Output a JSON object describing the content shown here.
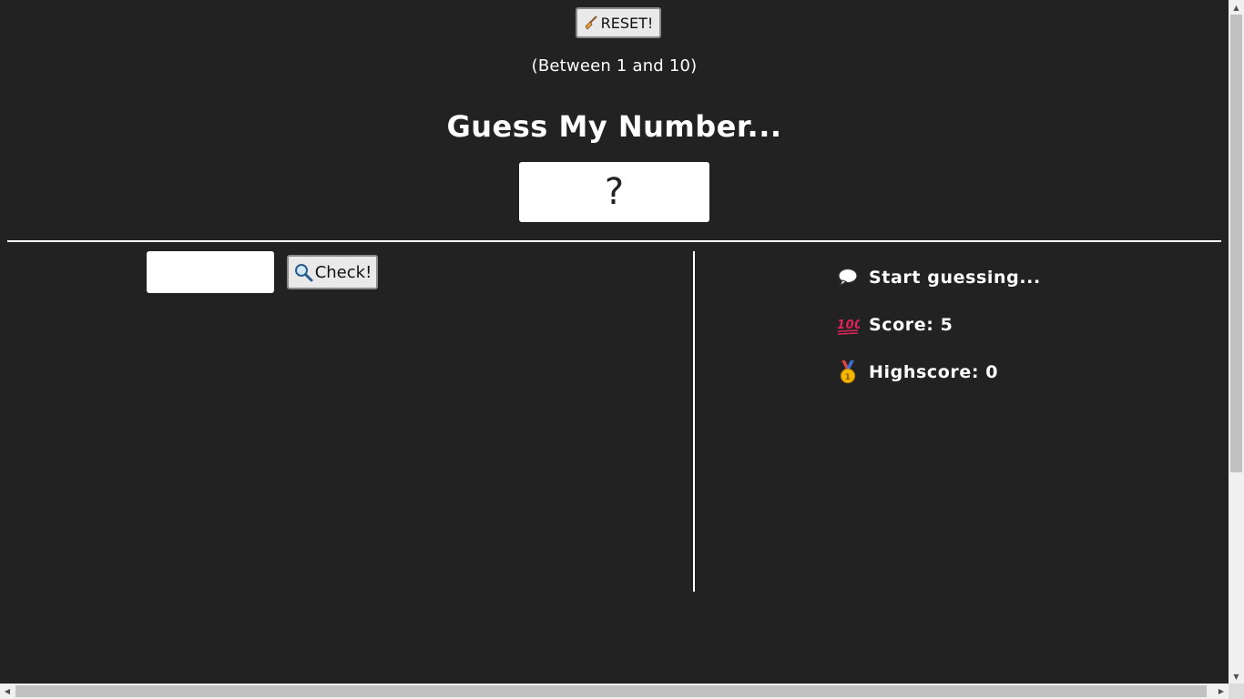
{
  "header": {
    "reset_label": "RESET!",
    "range_text": "(Between 1 and 10)",
    "title": "Guess My Number...",
    "secret_number": "?"
  },
  "guess": {
    "input_value": "",
    "check_label": "Check!"
  },
  "stats": {
    "message": "Start guessing...",
    "score_label": "Score: 5",
    "highscore_label": "Highscore: 0"
  },
  "icons": {
    "reset": "broom-icon",
    "check": "magnifier-icon",
    "message": "speech-bubble-icon",
    "score": "hundred-points-icon",
    "highscore": "medal-icon"
  },
  "colors": {
    "background": "#222222",
    "text": "#ffffff",
    "box": "#ffffff",
    "button_bg": "#e9e9e9"
  }
}
